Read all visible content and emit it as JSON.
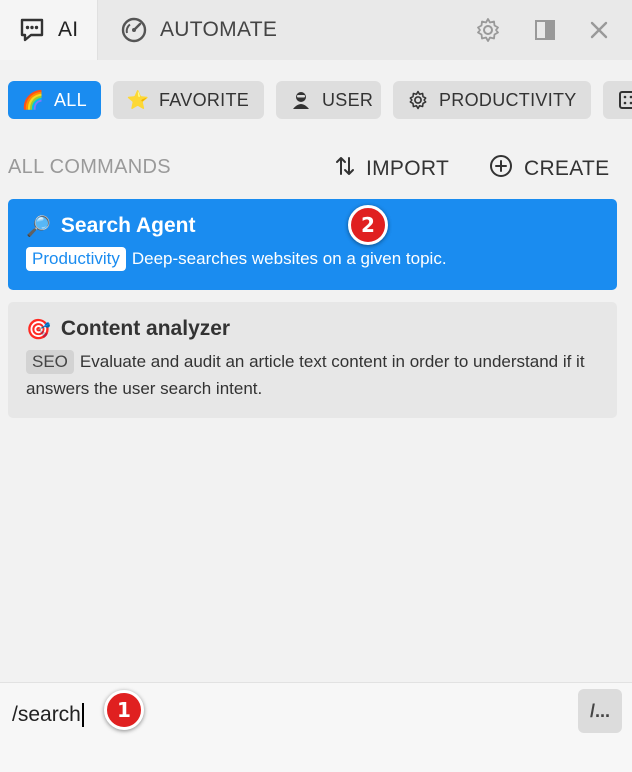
{
  "tabs": {
    "ai": "AI",
    "automate": "AUTOMATE"
  },
  "toolbar_icons": [
    "gear-icon",
    "sidebar-toggle-icon",
    "close-icon"
  ],
  "filters": [
    {
      "label": "ALL",
      "icon": "🌈",
      "active": true
    },
    {
      "label": "FAVORITE",
      "icon": "⭐"
    },
    {
      "label": "USER",
      "icon": "user-icon"
    },
    {
      "label": "PRODUCTIVITY",
      "icon": "gear-icon"
    }
  ],
  "section": {
    "title": "ALL COMMANDS",
    "import_label": "IMPORT",
    "create_label": "CREATE"
  },
  "commands": [
    {
      "icon": "🔎",
      "title": "Search Agent",
      "badge": "Productivity",
      "description": "Deep-searches websites on a given topic."
    },
    {
      "icon": "🎯",
      "title": "Content analyzer",
      "badge": "SEO",
      "description": "Evaluate and audit an article text content in order to understand if it answers the user search intent."
    }
  ],
  "markers": {
    "first": "1",
    "second": "2"
  },
  "input": {
    "value": "/search"
  },
  "slash_button_label": "/...",
  "colors": {
    "accent": "#1a8cf0",
    "marker": "#e02020"
  }
}
